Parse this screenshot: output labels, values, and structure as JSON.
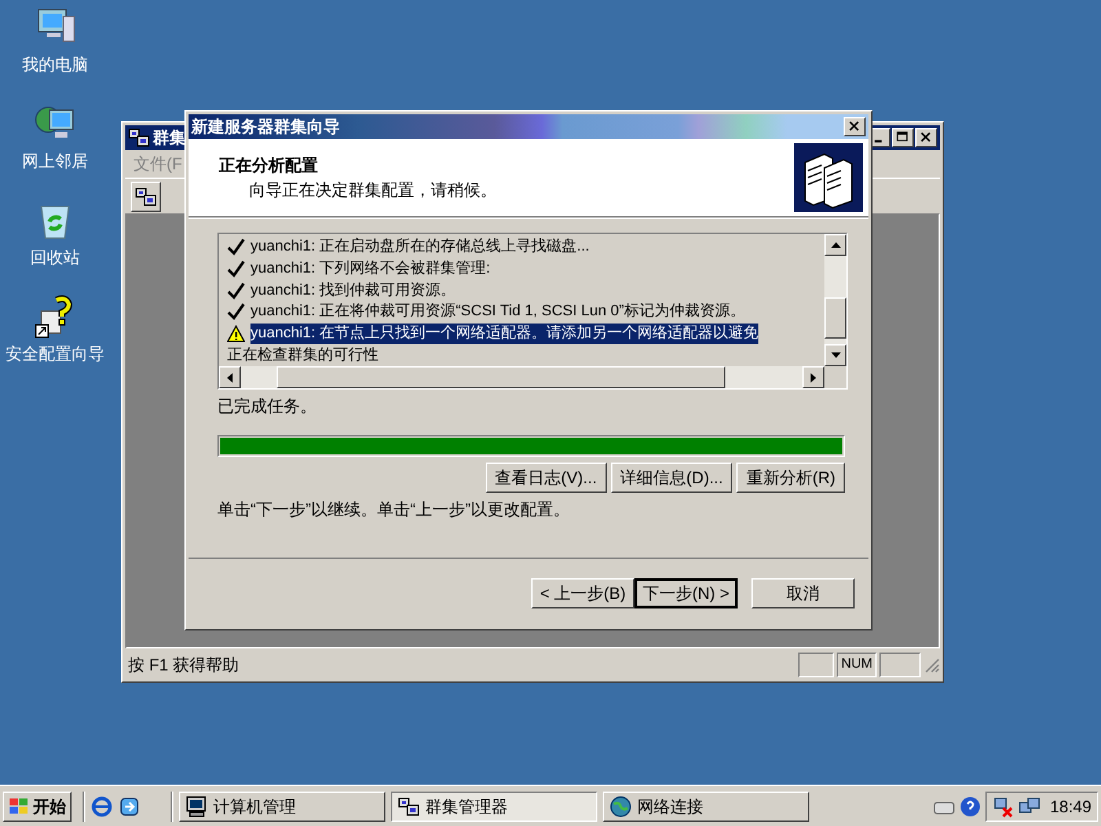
{
  "desktop_icons": [
    {
      "label": "我的电脑",
      "kind": "computer"
    },
    {
      "label": "网上邻居",
      "kind": "network"
    },
    {
      "label": "回收站",
      "kind": "recycle"
    },
    {
      "label": "安全配置向导",
      "kind": "wizard"
    }
  ],
  "background_window": {
    "title": "群集",
    "menu": [
      "文件(F"
    ],
    "status_text": "按 F1 获得帮助",
    "status_indicator": "NUM"
  },
  "wizard": {
    "title": "新建服务器群集向导",
    "heading": "正在分析配置",
    "subheading": "向导正在决定群集配置，请稍候。",
    "log": [
      {
        "text": "yuanchi1: 正在启动盘所在的存储总线上寻找磁盘...",
        "kind": "ok",
        "selected": false
      },
      {
        "text": "yuanchi1: 下列网络不会被群集管理:",
        "kind": "ok",
        "selected": false
      },
      {
        "text": "yuanchi1: 找到仲裁可用资源。",
        "kind": "ok",
        "selected": false
      },
      {
        "text": "yuanchi1: 正在将仲裁可用资源“SCSI Tid 1, SCSI Lun 0”标记为仲裁资源。",
        "kind": "ok",
        "selected": false
      },
      {
        "text": "yuanchi1: 在节点上只找到一个网络适配器。请添加另一个网络适配器以避免",
        "kind": "warning",
        "selected": true
      },
      {
        "text": "正在检查群集的可行性",
        "kind": "plain",
        "selected": false
      }
    ],
    "status": "已完成任务。",
    "progress": {
      "level": 1
    },
    "action_buttons": [
      "查看日志(V)...",
      "详细信息(D)...",
      "重新分析(R)"
    ],
    "hint": "单击“下一步”以继续。单击“上一步”以更改配置。",
    "nav_buttons": [
      {
        "label": "< 上一步(B)",
        "selected": false
      },
      {
        "label": "下一步(N) >",
        "selected": true
      },
      {
        "label": "取消",
        "selected": false
      }
    ]
  },
  "taskbar": {
    "start": "开始",
    "tasks": [
      {
        "label": "计算机管理",
        "kind": "computer",
        "selected": false
      },
      {
        "label": "群集管理器",
        "kind": "cluster",
        "selected": true
      },
      {
        "label": "网络连接",
        "kind": "network",
        "selected": false
      }
    ],
    "clock": "18:49"
  }
}
